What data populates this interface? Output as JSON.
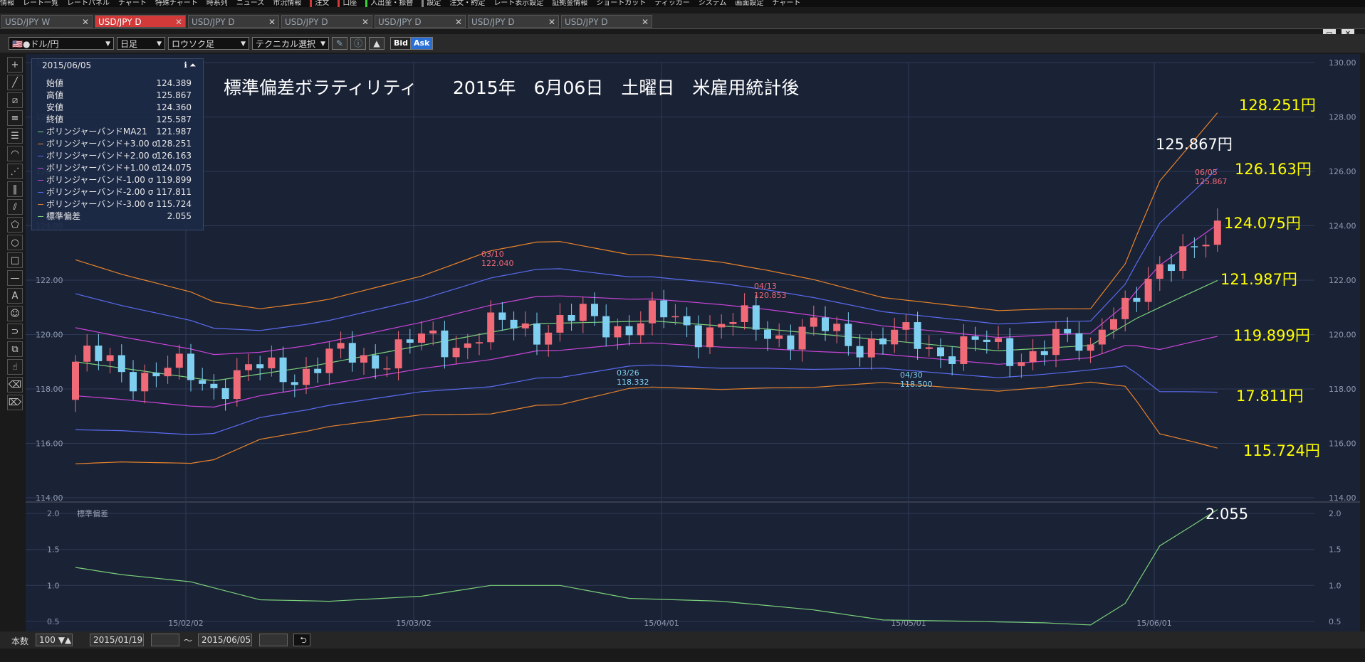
{
  "menu": {
    "items": [
      "情報",
      "レート一覧",
      "レートパネル",
      "チャート",
      "特殊チャート",
      "時系列",
      "ニュース",
      "市況情報",
      "注文",
      "口座",
      "入出金・振替",
      "設定",
      "注文・約定",
      "レート表示設定",
      "証拠金情報",
      "ショートカット",
      "ティッカー",
      "システム",
      "画面設定",
      "チャート"
    ]
  },
  "tabs": [
    {
      "label": "USD/JPY W",
      "active": false
    },
    {
      "label": "USD/JPY D",
      "active": true
    },
    {
      "label": "USD/JPY D",
      "active": false
    },
    {
      "label": "USD/JPY D",
      "active": false
    },
    {
      "label": "USD/JPY D",
      "active": false
    },
    {
      "label": "USD/JPY D",
      "active": false
    },
    {
      "label": "USD/JPY D",
      "active": false
    }
  ],
  "toolbar": {
    "pair": "ドル/円",
    "period": "日足",
    "chart_type": "ロウソク足",
    "technical": "テクニカル選択",
    "bid_label": "Bid",
    "ask_label": "Ask"
  },
  "info": {
    "date": "2015/06/05",
    "rows": [
      {
        "label": "始値",
        "value": "124.389",
        "color": ""
      },
      {
        "label": "高値",
        "value": "125.867",
        "color": ""
      },
      {
        "label": "安値",
        "value": "124.360",
        "color": ""
      },
      {
        "label": "終値",
        "value": "125.587",
        "color": ""
      },
      {
        "label": "ボリンジャーバンドMA21",
        "value": "121.987",
        "color": "#7ad07a"
      },
      {
        "label": "ボリンジャーバンド+3.00 σ",
        "value": "128.251",
        "color": "#e8832a"
      },
      {
        "label": "ボリンジャーバンド+2.00 σ",
        "value": "126.163",
        "color": "#5a6cf0"
      },
      {
        "label": "ボリンジャーバンド+1.00 σ",
        "value": "124.075",
        "color": "#c845d8"
      },
      {
        "label": "ボリンジャーバンド-1.00 σ",
        "value": "119.899",
        "color": "#c845d8"
      },
      {
        "label": "ボリンジャーバンド-2.00 σ",
        "value": "117.811",
        "color": "#5a6cf0"
      },
      {
        "label": "ボリンジャーバンド-3.00 σ",
        "value": "115.724",
        "color": "#e8832a"
      },
      {
        "label": "標準偏差",
        "value": "2.055",
        "color": "#7ad07a"
      }
    ]
  },
  "headline": "標準偏差ボラティリティ　　2015年　6月06日　土曜日　米雇用統計後",
  "annotations": {
    "high": "125.867円",
    "plus3": "128.251円",
    "plus2": "126.163円",
    "plus1": "124.075円",
    "ma": "121.987円",
    "minus1": "119.899円",
    "minus2": "17.811円",
    "minus3": "115.724円",
    "sd": "2.055"
  },
  "chart_data": {
    "type": "candlestick",
    "price_axis": {
      "ticks": [
        "130.00",
        "128.00",
        "126.00",
        "124.00",
        "122.00",
        "120.00",
        "118.00",
        "116.00",
        "114.00"
      ],
      "ylim": [
        114,
        130
      ]
    },
    "sd_axis": {
      "title": "標準偏差",
      "ticks": [
        "2.0",
        "1.5",
        "1.0",
        "0.5"
      ],
      "ylim": [
        0.4,
        2.1
      ]
    },
    "x_labels": [
      "15/02/02",
      "15/03/02",
      "15/04/01",
      "15/05/01",
      "15/06/01"
    ],
    "data_labels": [
      {
        "date": "03/10",
        "value": "122.040",
        "kind": "high"
      },
      {
        "date": "03/26",
        "value": "118.332",
        "kind": "low"
      },
      {
        "date": "04/13",
        "value": "120.853",
        "kind": "high"
      },
      {
        "date": "04/30",
        "value": "118.500",
        "kind": "low"
      },
      {
        "date": "06/05",
        "value": "125.867",
        "kind": "high"
      }
    ],
    "last_close": 125.587,
    "last_sd": 2.055
  },
  "bottom": {
    "count_label": "本数",
    "count": "100",
    "from_date": "2015/01/19",
    "to_sep": "～",
    "to_date": "2015/06/05"
  }
}
